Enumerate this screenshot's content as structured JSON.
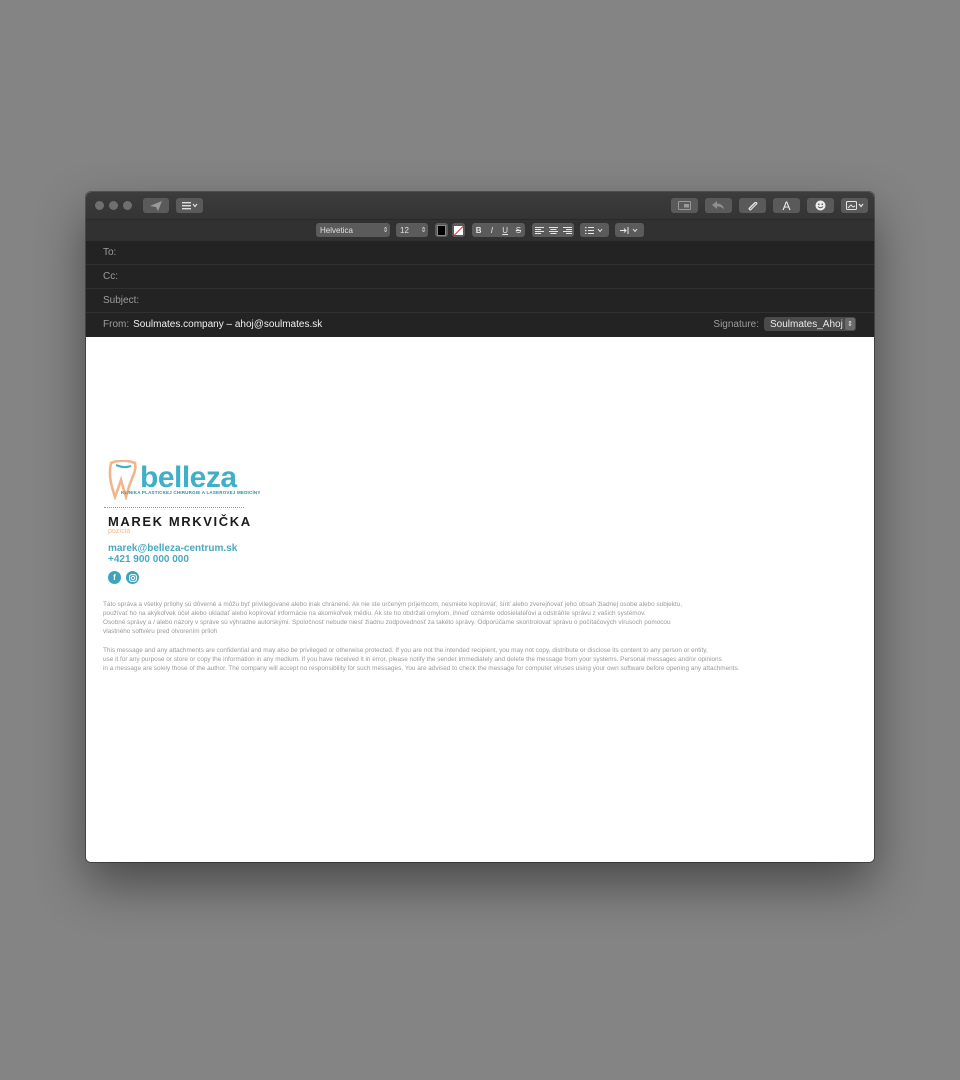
{
  "toolbar": {
    "icons": [
      "send-icon",
      "list-icon",
      "photo-browser-icon",
      "reply-icon",
      "attachment-icon",
      "font-icon",
      "emoji-icon",
      "photo-icon"
    ],
    "font_button_label": "A"
  },
  "format": {
    "font_family": "Helvetica",
    "font_size": "12",
    "bold": "B",
    "italic": "I",
    "underline": "U",
    "strike": "S",
    "text_color": "#000000"
  },
  "header": {
    "to_label": "To:",
    "to_value": "",
    "cc_label": "Cc:",
    "cc_value": "",
    "subject_label": "Subject:",
    "subject_value": "",
    "from_label": "From:",
    "from_value": "Soulmates.company – ahoj@soulmates.sk",
    "signature_label": "Signature:",
    "signature_value": "Soulmates_Ahoj"
  },
  "signature": {
    "logo_word": "belleza",
    "logo_tagline": "KLINIKA PLASTICKEJ CHIRURGIE A LASEROVEJ MEDICÍNY",
    "name": "MAREK MRKVIČKA",
    "role": "pozícia",
    "email": "marek@belleza-centrum.sk",
    "phone": "+421 900 000 000",
    "social": [
      "facebook-icon",
      "instagram-icon"
    ],
    "disclaimer_sk": [
      "Táto správa a všetky prílohy sú dôverné a môžu byť privilegované alebo inak chránené. Ak nie ste určeným príjemcom, nesmiete kopírovať, šíriť alebo zverejňovať jeho obsah žiadnej osobe alebo subjektu,",
      "používať ho na akýkoľvek účel alebo ukladať alebo kopírovať informácie na akomkoľvek médiu. Ak ste ho obdržali omylom, ihneď oznámte odosielateľovi a odstráňte správu z vašich systémov.",
      "Osobné správy a / alebo názory v správe sú výhradne autorskými. Spoločnosť nebude niesť žiadnu zodpovednosť za takéto správy. Odporúčame skontrolovať správu o počítačových vírusoch pomocou",
      "vlastného softvéru pred otvorením príloh"
    ],
    "disclaimer_en": [
      "This message and any attachments are confidential and may also be privileged or otherwise protected. If you are not the intended recipient, you may not copy, distribute or disclose its content to any person or entity,",
      "use it for any purpose or store or copy the information in any medium. If you have received it in error, please notify the sender immediately and delete the message from your systems. Personal messages and/or opinions",
      "in a message are solely those of the author. The company will accept no responsibility for such messages. You are advised to check the message for computer viruses using your own software before opening any attachments."
    ]
  }
}
